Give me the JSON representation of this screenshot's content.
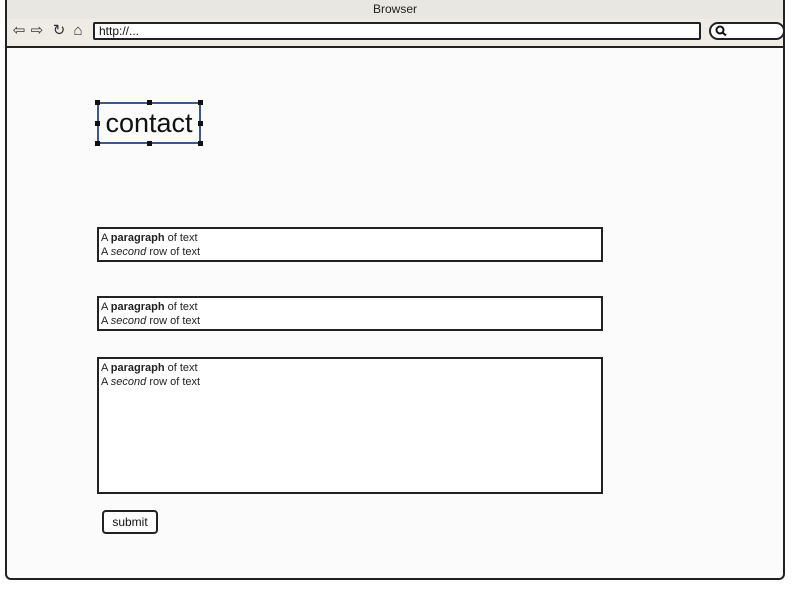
{
  "window": {
    "title": "Browser",
    "url": "http://..."
  },
  "page": {
    "heading": "contact",
    "textboxes": [
      {
        "line1_a": "A ",
        "line1_bold": "paragraph",
        "line1_b": " of text",
        "line2_a": "A ",
        "line2_italic": "second",
        "line2_b": " row of text"
      },
      {
        "line1_a": "A ",
        "line1_bold": "paragraph",
        "line1_b": " of text",
        "line2_a": "A ",
        "line2_italic": "second",
        "line2_b": " row of text"
      },
      {
        "line1_a": "A ",
        "line1_bold": "paragraph",
        "line1_b": " of text",
        "line2_a": "A ",
        "line2_italic": "second",
        "line2_b": " row of text"
      }
    ],
    "submit_label": "submit"
  },
  "icons": {
    "back": "back-arrow-icon",
    "forward": "forward-arrow-icon",
    "reload": "reload-icon",
    "home": "home-icon",
    "search": "search-icon"
  }
}
